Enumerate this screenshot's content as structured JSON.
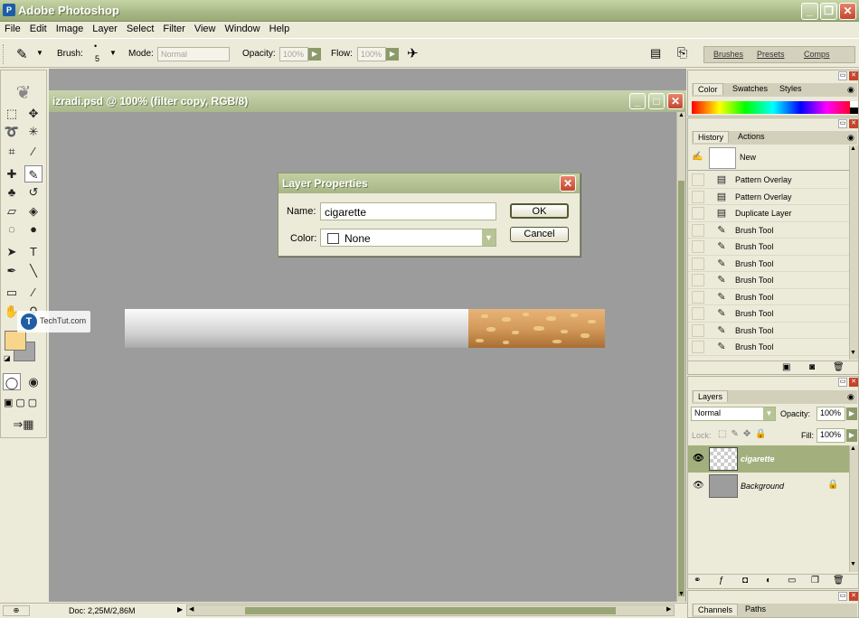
{
  "app": {
    "title": "Adobe Photoshop",
    "icon": "photoshop-app-icon"
  },
  "menubar": [
    "File",
    "Edit",
    "Image",
    "Layer",
    "Select",
    "Filter",
    "View",
    "Window",
    "Help"
  ],
  "options": {
    "brush_label": "Brush:",
    "brush_size": "5",
    "mode_label": "Mode:",
    "mode_value": "Normal",
    "opacity_label": "Opacity:",
    "opacity_value": "100%",
    "flow_label": "Flow:",
    "flow_value": "100%",
    "well_tabs": [
      "Brushes",
      "Presets",
      "Comps"
    ]
  },
  "document": {
    "title": "izradi.psd @ 100% (filter copy, RGB/8)"
  },
  "dialog": {
    "title": "Layer Properties",
    "name_label": "Name:",
    "name_value": "cigarette",
    "color_label": "Color:",
    "color_value": "None",
    "ok_label": "OK",
    "cancel_label": "Cancel"
  },
  "watermark": {
    "text": "TechTut.com"
  },
  "color_panel": {
    "tabs": [
      "Color",
      "Swatches",
      "Styles"
    ]
  },
  "history_panel": {
    "tabs": [
      "History",
      "Actions"
    ],
    "snapshot_label": "New",
    "items": [
      {
        "label": "Pattern Overlay",
        "icon": "document-icon"
      },
      {
        "label": "Pattern Overlay",
        "icon": "document-icon"
      },
      {
        "label": "Duplicate Layer",
        "icon": "document-icon"
      },
      {
        "label": "Brush Tool",
        "icon": "brush-icon"
      },
      {
        "label": "Brush Tool",
        "icon": "brush-icon"
      },
      {
        "label": "Brush Tool",
        "icon": "brush-icon"
      },
      {
        "label": "Brush Tool",
        "icon": "brush-icon"
      },
      {
        "label": "Brush Tool",
        "icon": "brush-icon"
      },
      {
        "label": "Brush Tool",
        "icon": "brush-icon"
      },
      {
        "label": "Brush Tool",
        "icon": "brush-icon"
      },
      {
        "label": "Brush Tool",
        "icon": "brush-icon"
      }
    ]
  },
  "layers_panel": {
    "tab": "Layers",
    "blend_mode": "Normal",
    "opacity_label": "Opacity:",
    "opacity_value": "100%",
    "lock_label": "Lock:",
    "fill_label": "Fill:",
    "fill_value": "100%",
    "layers": [
      {
        "name": "cigarette",
        "selected": true
      },
      {
        "name": "Background",
        "selected": false
      }
    ]
  },
  "bottom_panel": {
    "tabs": [
      "Channels",
      "Paths"
    ]
  },
  "statusbar": {
    "doc_info": "Doc: 2,25M/2,86M"
  },
  "colors": {
    "title_green": "#a7b886",
    "panel_bg": "#ecead9",
    "foreground_swatch": "#f7d68c",
    "background_swatch": "#a5a5a5",
    "layer_selected": "#a3b07d",
    "close_red": "#c2462c"
  }
}
